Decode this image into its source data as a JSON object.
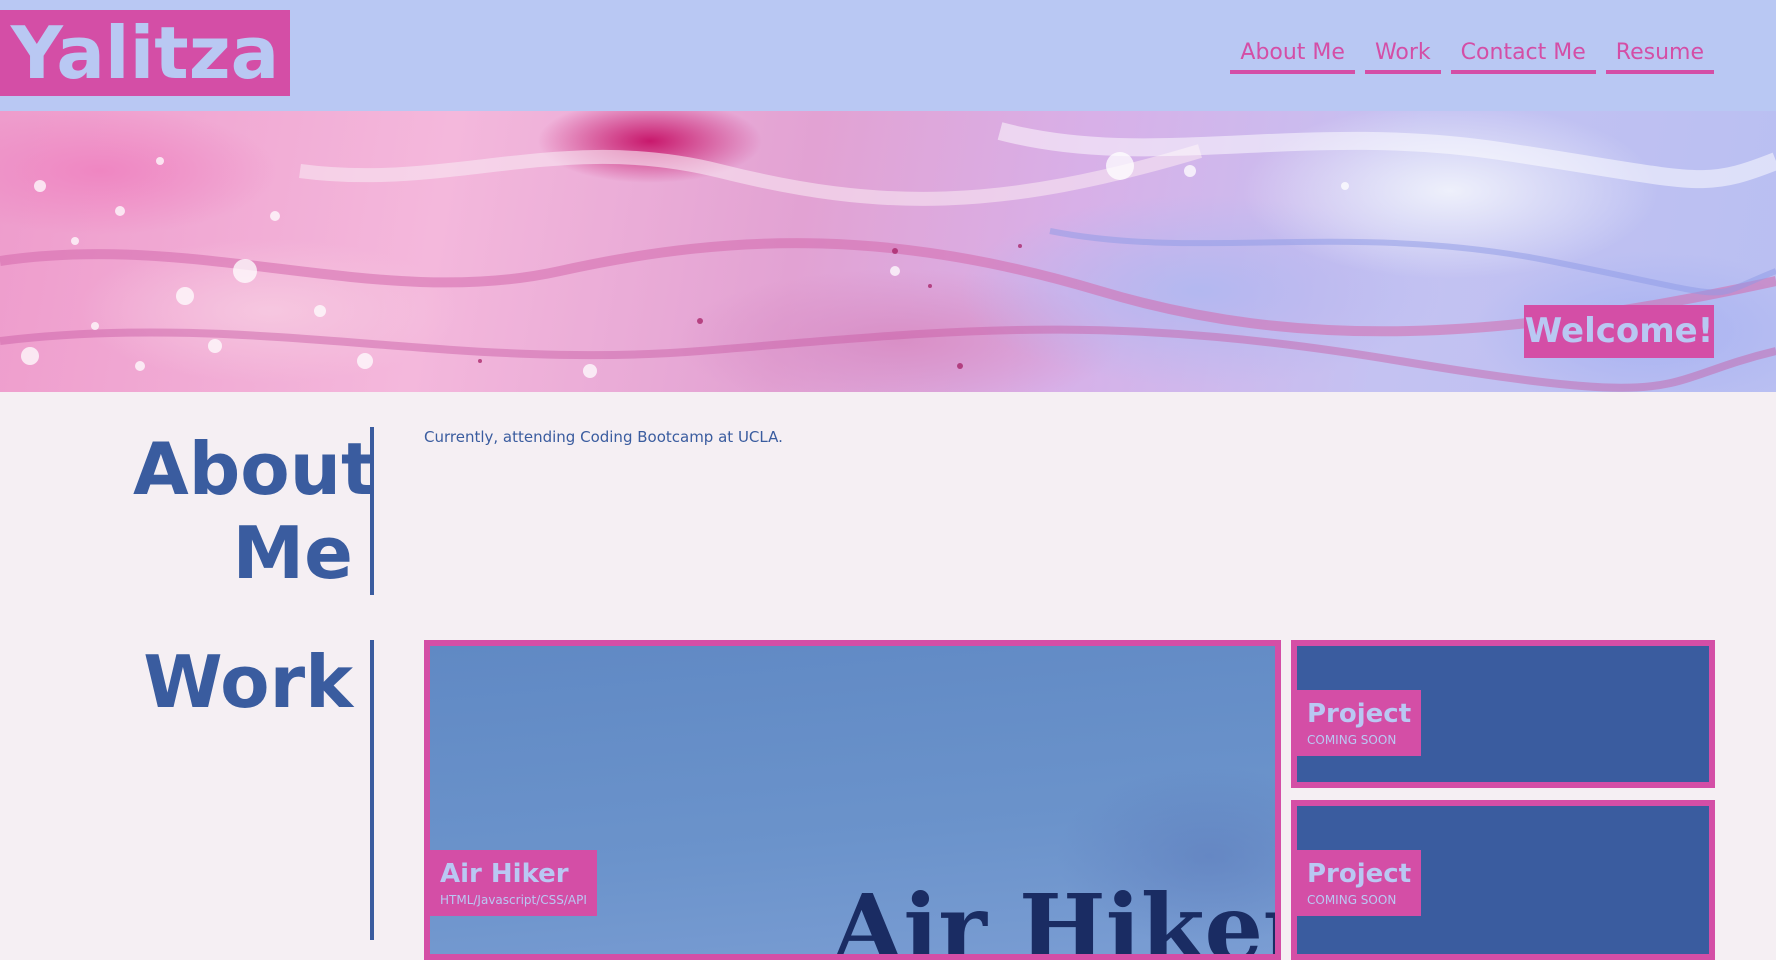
{
  "header": {
    "logo": "Yalitza",
    "nav": [
      "About Me",
      "Work",
      "Contact Me",
      "Resume"
    ]
  },
  "hero": {
    "welcome": "Welcome!"
  },
  "about": {
    "title_line1": "About",
    "title_line2": "Me",
    "text": "Currently, attending Coding Bootcamp at UCLA."
  },
  "work": {
    "title": "Work",
    "projects": [
      {
        "name": "Air Hiker",
        "subtitle": "HTML/Javascript/CSS/API",
        "image_title": "Air Hiker"
      },
      {
        "name": "Project",
        "subtitle": "COMING SOON"
      },
      {
        "name": "Project",
        "subtitle": "COMING SOON"
      }
    ]
  },
  "colors": {
    "header_bg": "#b9c8f3",
    "accent_pink": "#d44ea6",
    "text_blue": "#3a5c9f",
    "page_bg": "#f5eff3"
  }
}
